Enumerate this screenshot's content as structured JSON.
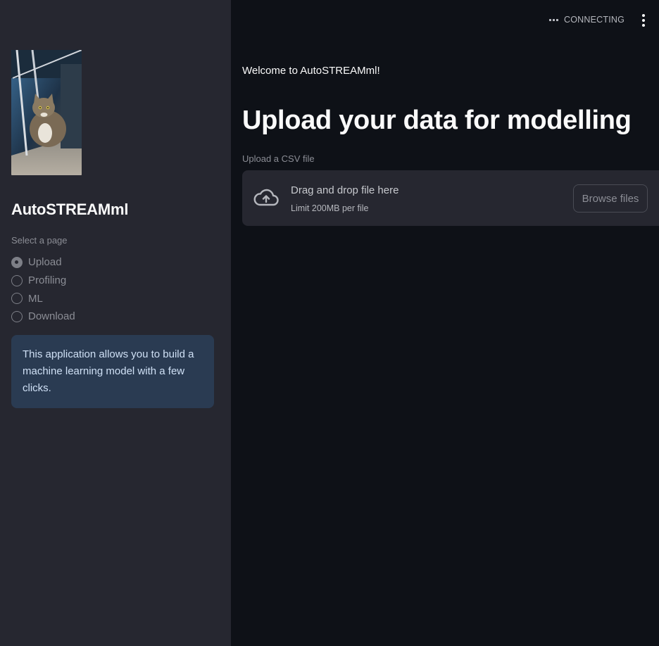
{
  "status": {
    "text": "CONNECTING"
  },
  "sidebar": {
    "title": "AutoSTREAMml",
    "radio_label": "Select a page",
    "pages": [
      {
        "label": "Upload",
        "selected": true
      },
      {
        "label": "Profiling",
        "selected": false
      },
      {
        "label": "ML",
        "selected": false
      },
      {
        "label": "Download",
        "selected": false
      }
    ],
    "info": "This application allows you to build a machine learning model with a few clicks."
  },
  "main": {
    "welcome": "Welcome to AutoSTREAMml!",
    "title": "Upload your data for modelling",
    "uploader": {
      "label": "Upload a CSV file",
      "drop_text": "Drag and drop file here",
      "limit_text": "Limit 200MB per file",
      "browse_label": "Browse files"
    }
  },
  "colors": {
    "background": "#0e1117",
    "sidebar": "#262730",
    "info_box": "#2a3b52",
    "text": "#fafafa"
  }
}
